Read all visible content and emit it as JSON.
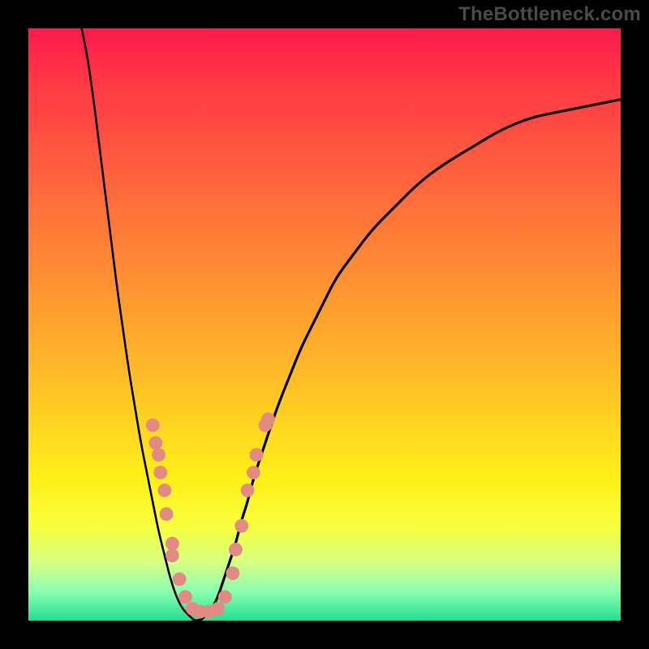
{
  "watermark": "TheBottleneck.com",
  "colors": {
    "background": "#000000",
    "gradient_top": "#ff1a4b",
    "gradient_bottom": "#20e090",
    "curve": "#000000",
    "dots": "#e38a84"
  },
  "chart_data": {
    "type": "line",
    "title": "",
    "xlabel": "",
    "ylabel": "",
    "xlim": [
      0,
      100
    ],
    "ylim": [
      0,
      100
    ],
    "grid": false,
    "legend": false,
    "series": [
      {
        "name": "bottleneck-curve",
        "x": [
          9,
          10,
          11,
          12,
          13,
          14,
          15,
          16,
          17,
          18,
          19,
          20,
          21,
          22,
          23,
          24,
          25,
          26,
          27,
          28,
          29,
          30,
          31,
          32,
          33,
          34,
          35,
          36,
          37,
          38,
          40,
          42,
          44,
          46,
          48,
          50,
          52,
          55,
          58,
          62,
          66,
          70,
          75,
          80,
          85,
          90,
          95,
          100
        ],
        "y": [
          100,
          95,
          88,
          80,
          72,
          64,
          56,
          49,
          42,
          36,
          30,
          25,
          20,
          15,
          11,
          7,
          4,
          2,
          1,
          0,
          0,
          1,
          2,
          4,
          7,
          10,
          13,
          17,
          20,
          24,
          30,
          36,
          41,
          46,
          50,
          54,
          58,
          62,
          66,
          70,
          74,
          77,
          80,
          83,
          85,
          86,
          87,
          88
        ]
      }
    ],
    "markers": {
      "name": "highlight-dots",
      "points": [
        {
          "x": 21.0,
          "y": 33.0
        },
        {
          "x": 21.5,
          "y": 30.0
        },
        {
          "x": 22.0,
          "y": 28.0
        },
        {
          "x": 22.3,
          "y": 25.0
        },
        {
          "x": 23.0,
          "y": 22.0
        },
        {
          "x": 23.3,
          "y": 18.0
        },
        {
          "x": 24.3,
          "y": 13.0
        },
        {
          "x": 24.3,
          "y": 11.0
        },
        {
          "x": 25.5,
          "y": 7.0
        },
        {
          "x": 26.5,
          "y": 4.0
        },
        {
          "x": 27.7,
          "y": 2.0
        },
        {
          "x": 29.0,
          "y": 1.5
        },
        {
          "x": 30.5,
          "y": 1.5
        },
        {
          "x": 32.0,
          "y": 2.0
        },
        {
          "x": 33.2,
          "y": 4.0
        },
        {
          "x": 34.5,
          "y": 8.0
        },
        {
          "x": 35.0,
          "y": 12.0
        },
        {
          "x": 36.0,
          "y": 16.0
        },
        {
          "x": 37.0,
          "y": 22.0
        },
        {
          "x": 38.0,
          "y": 25.0
        },
        {
          "x": 38.5,
          "y": 28.0
        },
        {
          "x": 40.0,
          "y": 33.0
        },
        {
          "x": 40.5,
          "y": 34.0
        }
      ]
    }
  }
}
